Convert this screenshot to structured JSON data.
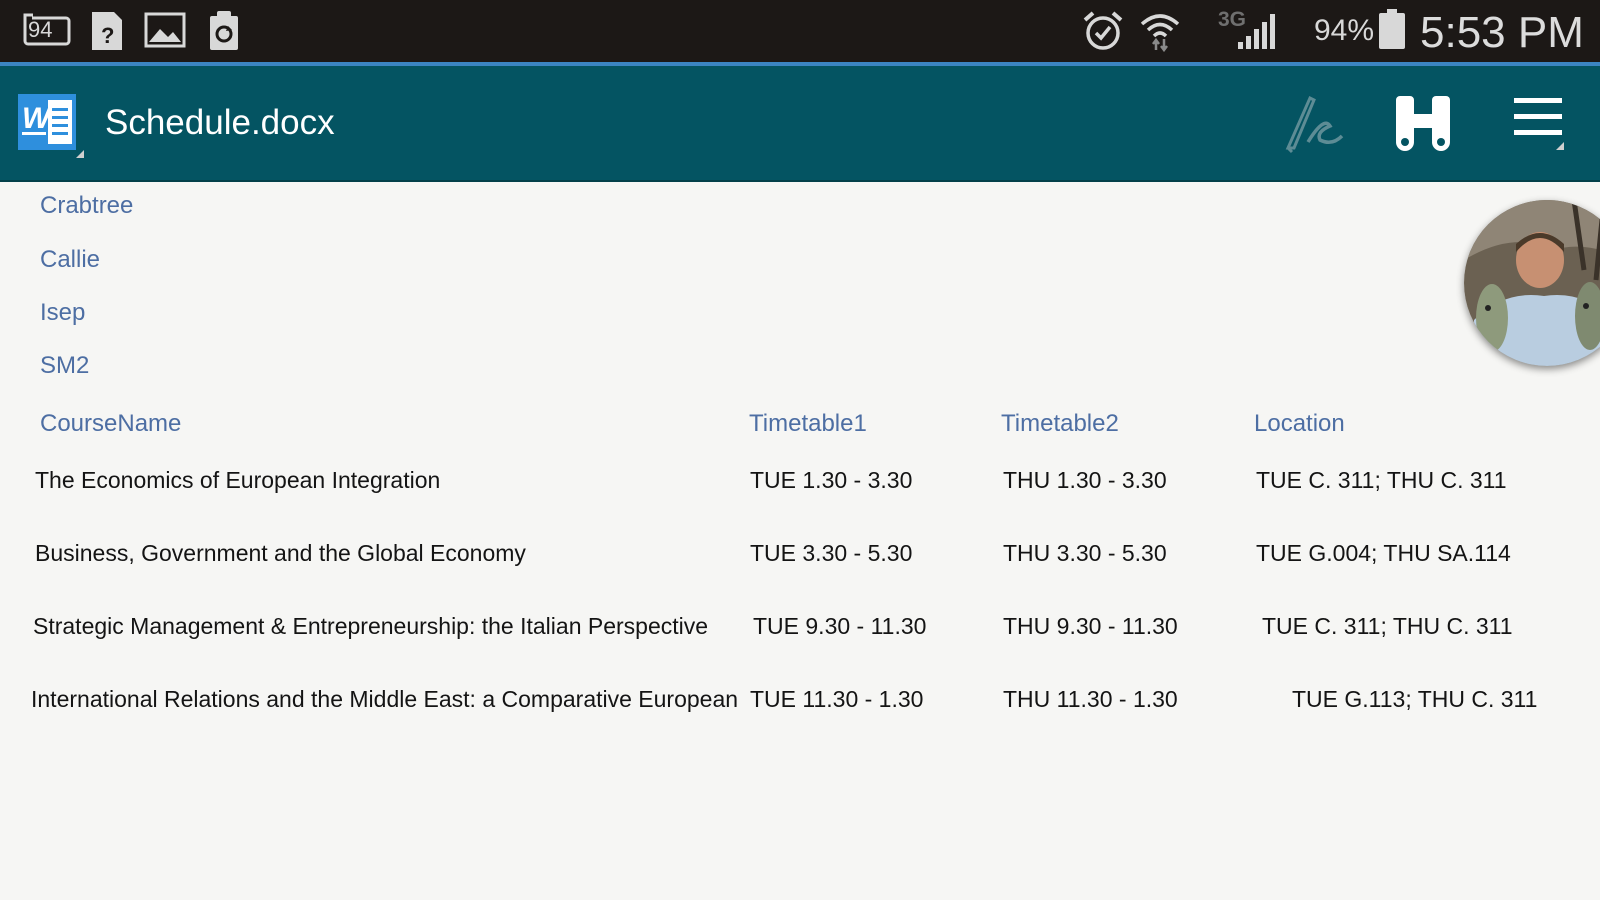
{
  "status_bar": {
    "notification_badge": "94",
    "network_type": "3G",
    "battery_percent": "94%",
    "time": "5:53 PM"
  },
  "app_bar": {
    "title": "Schedule.docx",
    "logo_letter": "W"
  },
  "document": {
    "meta_lines": [
      "Crabtree",
      "Callie",
      "Isep",
      "SM2"
    ],
    "table": {
      "headers": [
        "CourseName",
        "Timetable1",
        "Timetable2",
        "Location"
      ],
      "rows": [
        [
          "The Economics of European Integration",
          "TUE 1.30 - 3.30",
          "THU 1.30 - 3.30",
          "TUE C. 311; THU C. 311"
        ],
        [
          "Business, Government and the Global Economy",
          "TUE 3.30 - 5.30",
          "THU 3.30 - 5.30",
          "TUE G.004; THU SA.114"
        ],
        [
          "Strategic Management & Entrepreneurship: the Italian Perspective",
          "TUE 9.30 - 11.30",
          "THU 9.30 - 11.30",
          "TUE C. 311; THU C. 311"
        ],
        [
          "International Relations and the Middle East: a Comparative European",
          "TUE 11.30 - 1.30",
          "THU 11.30 - 1.30",
          "TUE G.113; THU C. 311"
        ]
      ]
    }
  },
  "colors": {
    "status_bar_bg": "#1c1816",
    "app_bar_bg": "#045462",
    "accent_line": "#3c85c2",
    "heading_blue": "#4d6ea3",
    "page_bg": "#f6f6f4"
  },
  "icons": [
    "screenshot-notification-icon",
    "unknown-file-icon",
    "image-icon",
    "recycle-icon",
    "alarm-icon",
    "wifi-icon",
    "signal-icon",
    "battery-icon",
    "word-logo-icon",
    "sign-pen-icon",
    "binoculars-icon",
    "menu-icon",
    "profile-photo"
  ]
}
